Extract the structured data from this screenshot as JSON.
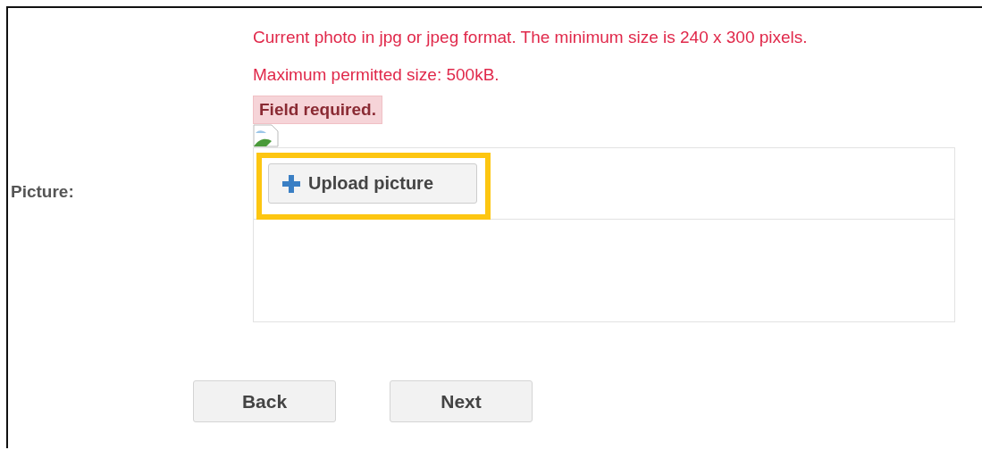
{
  "notes": [
    "Current photo in jpg or jpeg format. The minimum size is 240 x 300 pixels.",
    "Maximum permitted size: 500kB."
  ],
  "error": "Field required.",
  "field": {
    "label": "Picture:",
    "upload_button": {
      "label": "Upload picture",
      "highlighted": true
    }
  },
  "buttons": [
    {
      "label": "Back"
    },
    {
      "label": "Next"
    }
  ]
}
